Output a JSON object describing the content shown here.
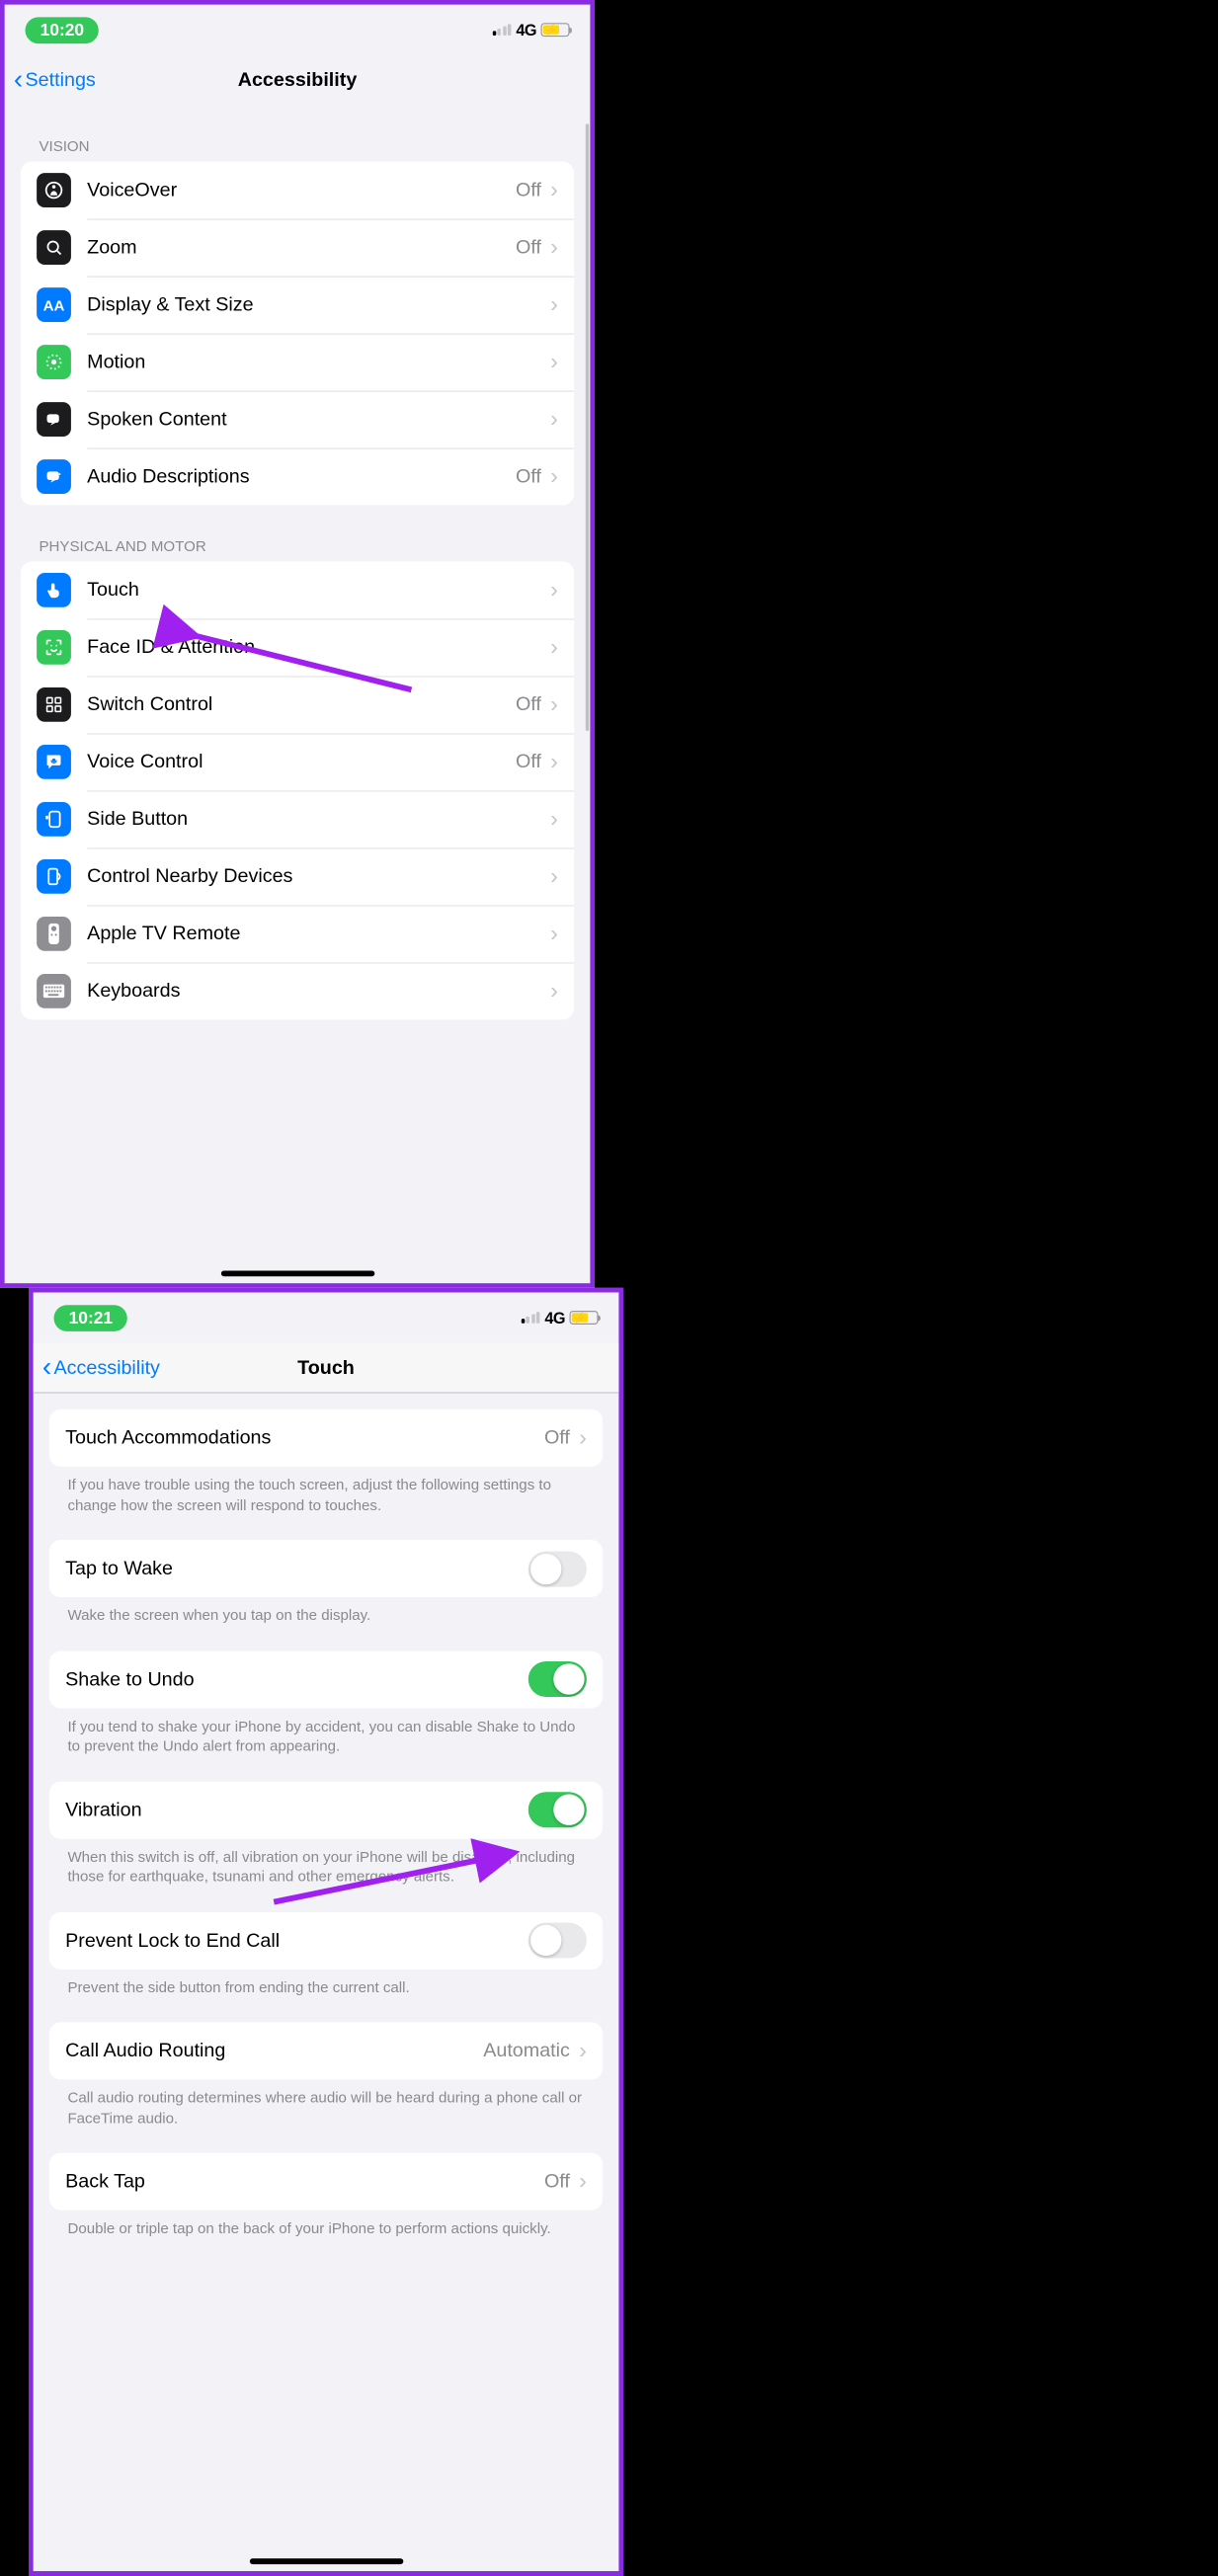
{
  "screens": {
    "left": {
      "status": {
        "time": "10:20",
        "network": "4G"
      },
      "nav": {
        "back": "Settings",
        "title": "Accessibility"
      },
      "section1_header": "VISION",
      "vision": [
        {
          "label": "VoiceOver",
          "value": "Off"
        },
        {
          "label": "Zoom",
          "value": "Off"
        },
        {
          "label": "Display & Text Size",
          "value": ""
        },
        {
          "label": "Motion",
          "value": ""
        },
        {
          "label": "Spoken Content",
          "value": ""
        },
        {
          "label": "Audio Descriptions",
          "value": "Off"
        }
      ],
      "section2_header": "PHYSICAL AND MOTOR",
      "motor": [
        {
          "label": "Touch",
          "value": ""
        },
        {
          "label": "Face ID & Attention",
          "value": ""
        },
        {
          "label": "Switch Control",
          "value": "Off"
        },
        {
          "label": "Voice Control",
          "value": "Off"
        },
        {
          "label": "Side Button",
          "value": ""
        },
        {
          "label": "Control Nearby Devices",
          "value": ""
        },
        {
          "label": "Apple TV Remote",
          "value": ""
        },
        {
          "label": "Keyboards",
          "value": ""
        }
      ]
    },
    "right": {
      "status": {
        "time": "10:21",
        "network": "4G"
      },
      "nav": {
        "back": "Accessibility",
        "title": "Touch"
      },
      "touch_accom": {
        "label": "Touch Accommodations",
        "value": "Off"
      },
      "touch_accom_footer": "If you have trouble using the touch screen, adjust the following settings to change how the screen will respond to touches.",
      "tap_wake": {
        "label": "Tap to Wake",
        "on": false
      },
      "tap_wake_footer": "Wake the screen when you tap on the display.",
      "shake": {
        "label": "Shake to Undo",
        "on": true
      },
      "shake_footer": "If you tend to shake your iPhone by accident, you can disable Shake to Undo to prevent the Undo alert from appearing.",
      "vibration": {
        "label": "Vibration",
        "on": true
      },
      "vibration_footer": "When this switch is off, all vibration on your iPhone will be disabled, including those for earthquake, tsunami and other emergency alerts.",
      "lock_call": {
        "label": "Prevent Lock to End Call",
        "on": false
      },
      "lock_call_footer": "Prevent the side button from ending the current call.",
      "audio_routing": {
        "label": "Call Audio Routing",
        "value": "Automatic"
      },
      "audio_routing_footer": "Call audio routing determines where audio will be heard during a phone call or FaceTime audio.",
      "back_tap": {
        "label": "Back Tap",
        "value": "Off"
      },
      "back_tap_footer": "Double or triple tap on the back of your iPhone to perform actions quickly."
    }
  }
}
